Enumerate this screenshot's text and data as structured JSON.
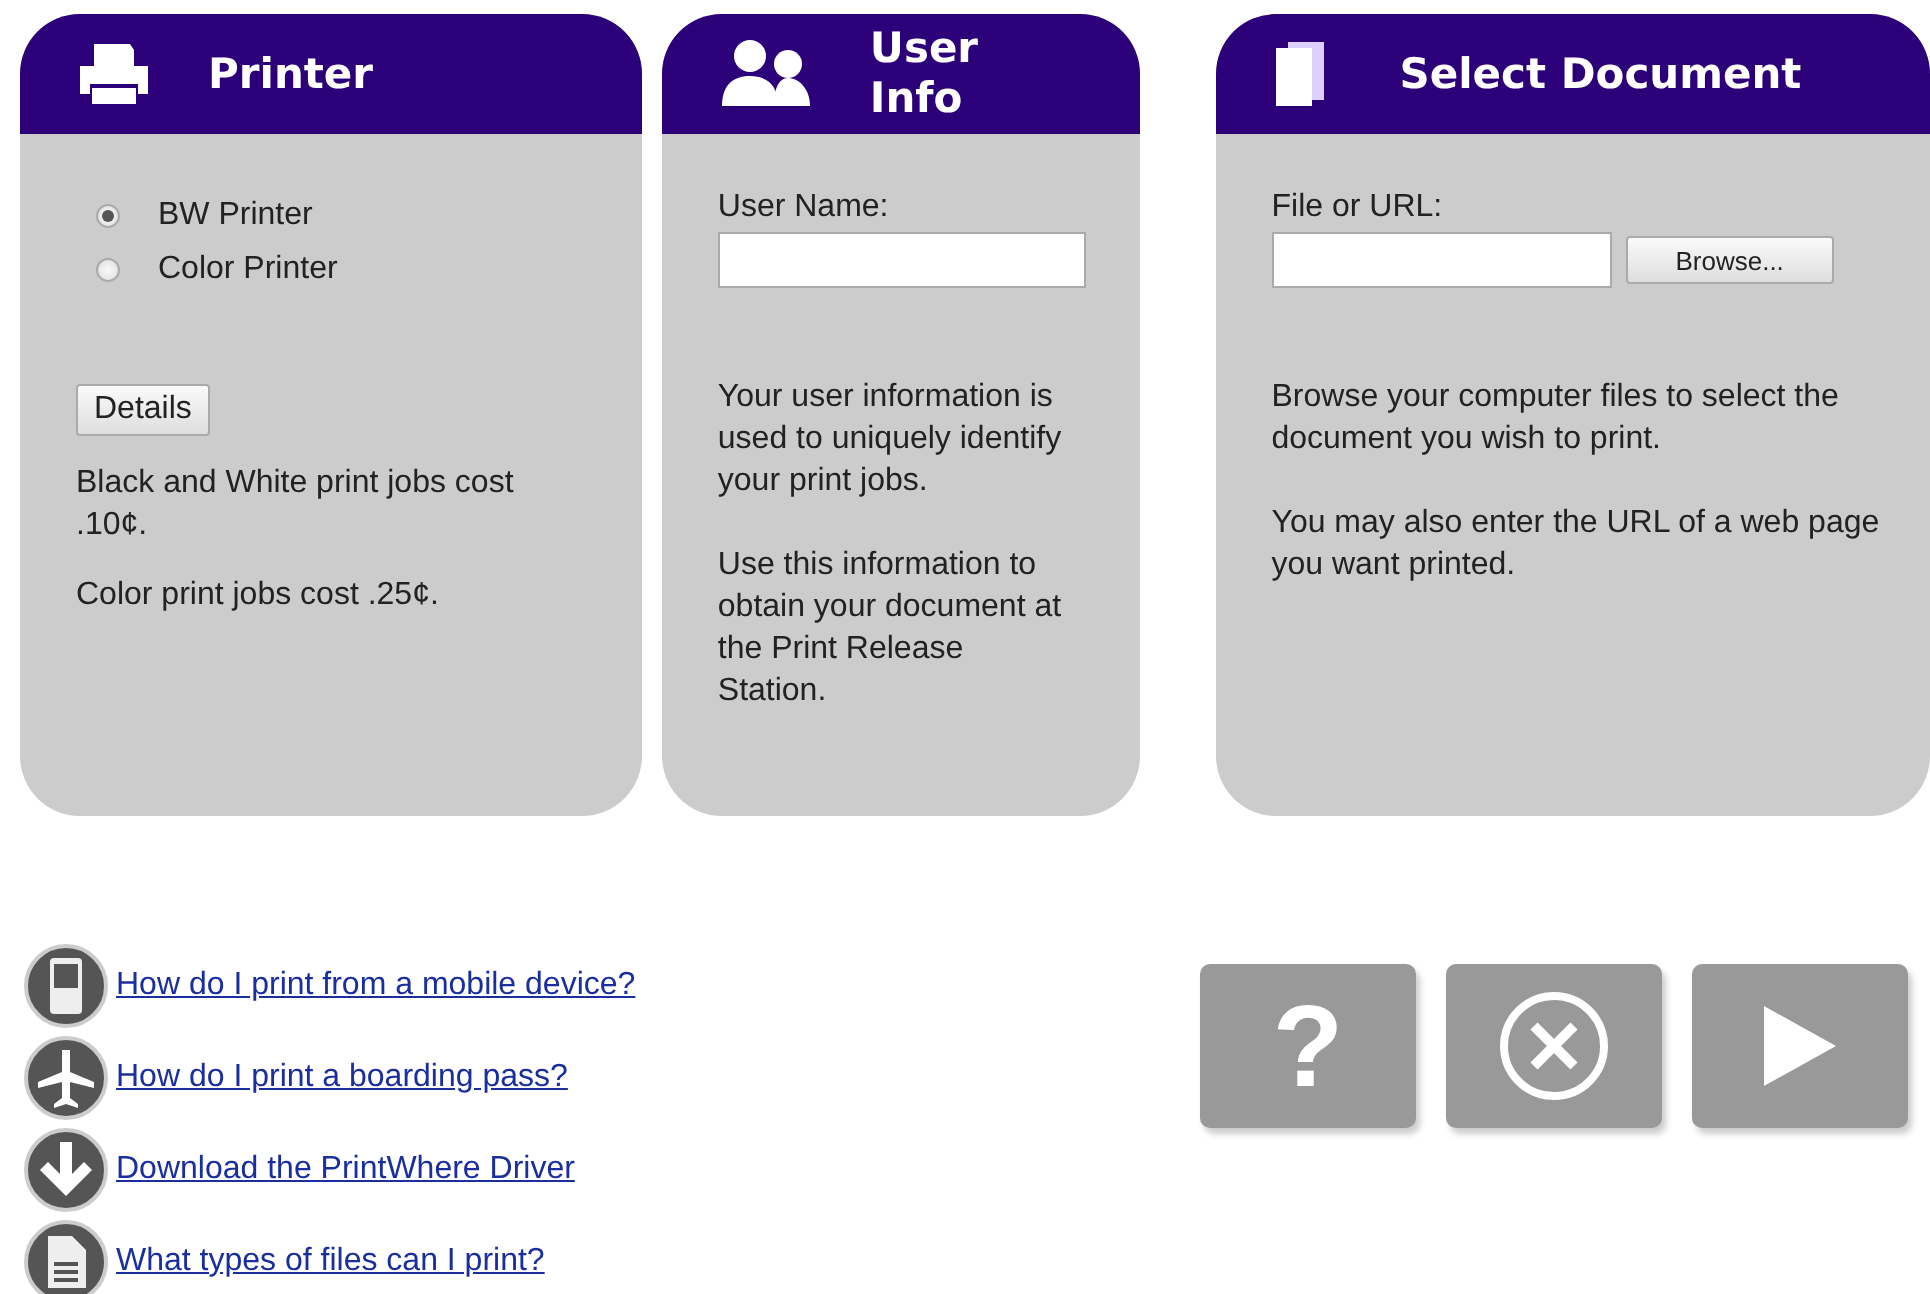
{
  "panels": [
    {
      "kind": "printer",
      "title": "Printer",
      "printers": [
        {
          "label": "BW Printer",
          "selected": true
        },
        {
          "label": "Color Printer",
          "selected": false
        }
      ],
      "details_button": "Details",
      "notes": [
        "Black and White print jobs cost .10¢.",
        "Color print jobs cost .25¢."
      ]
    },
    {
      "kind": "user",
      "title": "User Info",
      "field_label": "User Name:",
      "notes": [
        "Your user information is used to uniquely identify your print jobs.",
        "Use this information to obtain your document at the Print Release Station."
      ]
    },
    {
      "kind": "document",
      "title": "Select Document",
      "field_label": "File or URL:",
      "browse_button": "Browse...",
      "notes": [
        "Browse your computer files to select the document you wish to print.",
        "You may also enter the URL of a web page you want printed."
      ]
    }
  ],
  "help_links": [
    {
      "kind": "mobile",
      "label": "How do I print from a mobile device?"
    },
    {
      "kind": "plane",
      "label": "How do I print a boarding pass?"
    },
    {
      "kind": "download",
      "label": "Download the PrintWhere Driver"
    },
    {
      "kind": "file",
      "label": "What types of files can I print?"
    }
  ],
  "actions": [
    {
      "kind": "help",
      "label": "?"
    },
    {
      "kind": "cancel"
    },
    {
      "kind": "next"
    }
  ]
}
